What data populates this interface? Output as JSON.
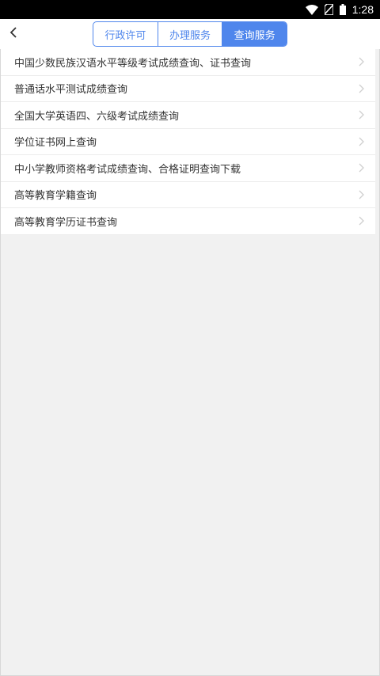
{
  "status_bar": {
    "time": "1:28",
    "icons": [
      "wifi-icon",
      "no-sim-icon",
      "battery-icon"
    ]
  },
  "header": {
    "back_icon": "chevron-left-icon",
    "tabs": [
      {
        "label": "行政许可",
        "active": false
      },
      {
        "label": "办理服务",
        "active": false
      },
      {
        "label": "查询服务",
        "active": true
      }
    ]
  },
  "list": {
    "items": [
      {
        "label": "中国少数民族汉语水平等级考试成绩查询、证书查询"
      },
      {
        "label": "普通话水平测试成绩查询"
      },
      {
        "label": "全国大学英语四、六级考试成绩查询"
      },
      {
        "label": "学位证书网上查询"
      },
      {
        "label": "中小学教师资格考试成绩查询、合格证明查询下载"
      },
      {
        "label": "高等教育学籍查询"
      },
      {
        "label": "高等教育学历证书查询"
      }
    ]
  },
  "colors": {
    "accent": "#4f86ec",
    "background": "#f1f1f1",
    "text": "#333333"
  }
}
